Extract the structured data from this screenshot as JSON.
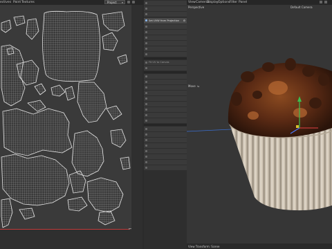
{
  "menu": {
    "left_items": [
      "ectives",
      "Paint",
      "Textures"
    ],
    "mode_select": "Project",
    "viewport_items": [
      "View",
      "Cameras",
      "Display",
      "Options",
      "Filter",
      "Panel"
    ]
  },
  "tools": {
    "active_label": "Set UVW from Projection",
    "section2_label": "Fit UV to Canvas"
  },
  "viewport": {
    "projection_label": "Perspective",
    "camera_label": "Default Camera",
    "side_label": "Move",
    "footer_label": "View Transform: Scene"
  },
  "colors": {
    "accent": "#4a90d9",
    "axis_red": "#c23a3a",
    "axis_green": "#3bbf4f",
    "axis_blue": "#4a7cff",
    "cup": "#d9cfc0",
    "chocolate": "#4a2415"
  },
  "icons": {
    "settings": "gear-icon",
    "move": "move-icon"
  }
}
